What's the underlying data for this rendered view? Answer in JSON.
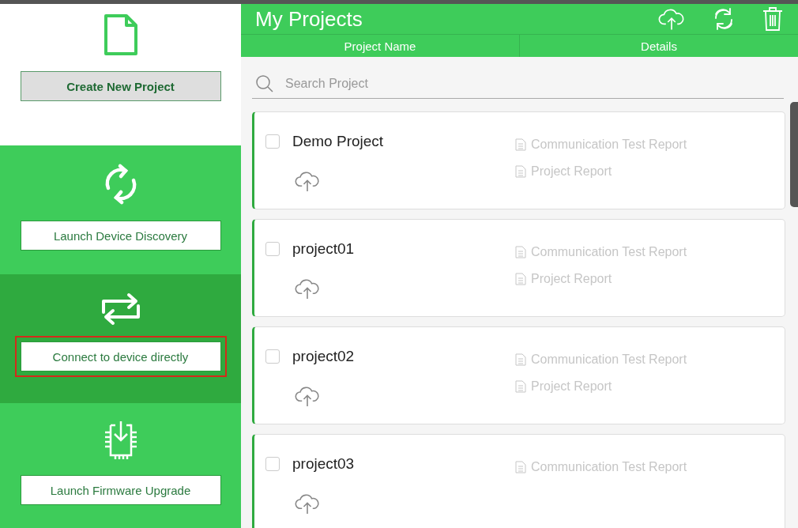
{
  "sidebar": {
    "items": [
      {
        "kind": "create",
        "label": "Create New Project",
        "selected": false,
        "highlighted": false
      },
      {
        "kind": "discovery",
        "label": "Launch Device Discovery",
        "selected": false,
        "highlighted": false
      },
      {
        "kind": "connect",
        "label": "Connect to device directly",
        "selected": true,
        "highlighted": true
      },
      {
        "kind": "firmware",
        "label": "Launch Firmware Upgrade",
        "selected": false,
        "highlighted": false
      }
    ]
  },
  "header": {
    "title": "My Projects"
  },
  "columns": [
    "Project Name",
    "Details"
  ],
  "search": {
    "placeholder": "Search Project"
  },
  "projects": [
    {
      "name": "Demo Project",
      "checked": false,
      "reports": [
        "Communication Test Report",
        "Project Report"
      ]
    },
    {
      "name": "project01",
      "checked": false,
      "reports": [
        "Communication Test Report",
        "Project Report"
      ]
    },
    {
      "name": "project02",
      "checked": false,
      "reports": [
        "Communication Test Report",
        "Project Report"
      ]
    },
    {
      "name": "project03",
      "checked": false,
      "reports": [
        "Communication Test Report"
      ]
    }
  ]
}
